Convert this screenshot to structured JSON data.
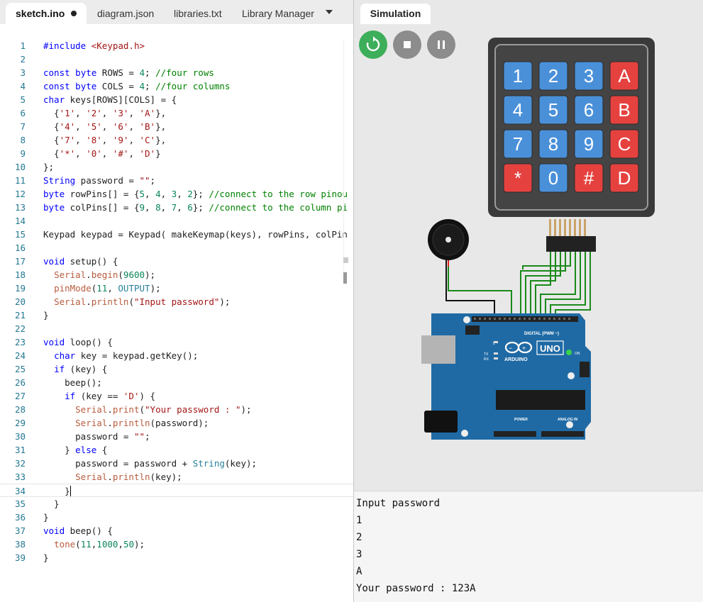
{
  "editor": {
    "tabs": [
      {
        "label": "sketch.ino",
        "unsaved": true
      },
      {
        "label": "diagram.json"
      },
      {
        "label": "libraries.txt"
      },
      {
        "label": "Library Manager"
      }
    ],
    "line_numbers": [
      "1",
      "2",
      "3",
      "4",
      "5",
      "6",
      "7",
      "8",
      "9",
      "10",
      "11",
      "12",
      "13",
      "14",
      "15",
      "16",
      "17",
      "18",
      "19",
      "20",
      "21",
      "22",
      "23",
      "24",
      "25",
      "26",
      "27",
      "28",
      "29",
      "30",
      "31",
      "32",
      "33",
      "34",
      "35",
      "36",
      "37",
      "38",
      "39"
    ],
    "code_lines": [
      "#include <Keypad.h>",
      "",
      "const byte ROWS = 4; //four rows",
      "const byte COLS = 4; //four columns",
      "char keys[ROWS][COLS] = {",
      "  {'1', '2', '3', 'A'},",
      "  {'4', '5', '6', 'B'},",
      "  {'7', '8', '9', 'C'},",
      "  {'*', '0', '#', 'D'}",
      "};",
      "String password = \"\";",
      "byte rowPins[] = {5, 4, 3, 2}; //connect to the row pinou",
      "byte colPins[] = {9, 8, 7, 6}; //connect to the column pi",
      "",
      "Keypad keypad = Keypad( makeKeymap(keys), rowPins, colPin",
      "",
      "void setup() {",
      "  Serial.begin(9600);",
      "  pinMode(11, OUTPUT);",
      "  Serial.println(\"Input password\");",
      "}",
      "",
      "void loop() {",
      "  char key = keypad.getKey();",
      "  if (key) {",
      "    beep();",
      "    if (key == 'D') {",
      "      Serial.print(\"Your password : \");",
      "      Serial.println(password);",
      "      password = \"\";",
      "    } else {",
      "      password = password + String(key);",
      "      Serial.println(key);",
      "    }",
      "  }",
      "}",
      "void beep() {",
      "  tone(11,1000,50);",
      "}"
    ],
    "current_line": 34
  },
  "simulation": {
    "tab_label": "Simulation",
    "controls": {
      "restart_color": "#3dae5a",
      "button_color": "#8c8c8c"
    },
    "keypad_keys": [
      {
        "label": "1",
        "color": "#4a90d9"
      },
      {
        "label": "2",
        "color": "#4a90d9"
      },
      {
        "label": "3",
        "color": "#4a90d9"
      },
      {
        "label": "A",
        "color": "#e5423f"
      },
      {
        "label": "4",
        "color": "#4a90d9"
      },
      {
        "label": "5",
        "color": "#4a90d9"
      },
      {
        "label": "6",
        "color": "#4a90d9"
      },
      {
        "label": "B",
        "color": "#e5423f"
      },
      {
        "label": "7",
        "color": "#4a90d9"
      },
      {
        "label": "8",
        "color": "#4a90d9"
      },
      {
        "label": "9",
        "color": "#4a90d9"
      },
      {
        "label": "C",
        "color": "#e5423f"
      },
      {
        "label": "*",
        "color": "#e5423f"
      },
      {
        "label": "0",
        "color": "#4a90d9"
      },
      {
        "label": "#",
        "color": "#e5423f"
      },
      {
        "label": "D",
        "color": "#e5423f"
      }
    ],
    "board": {
      "name": "UNO",
      "brand": "ARDUINO",
      "digital_label": "DIGITAL (PWM ~)",
      "power_label": "POWER",
      "analog_label": "ANALOG IN",
      "on_label": "ON",
      "l_label": "L",
      "tx_label": "TX",
      "rx_label": "RX",
      "color": "#1f6aa5"
    }
  },
  "serial_monitor": {
    "lines": [
      "Input password",
      "1",
      "2",
      "3",
      "A",
      "Your password : 123A"
    ]
  }
}
